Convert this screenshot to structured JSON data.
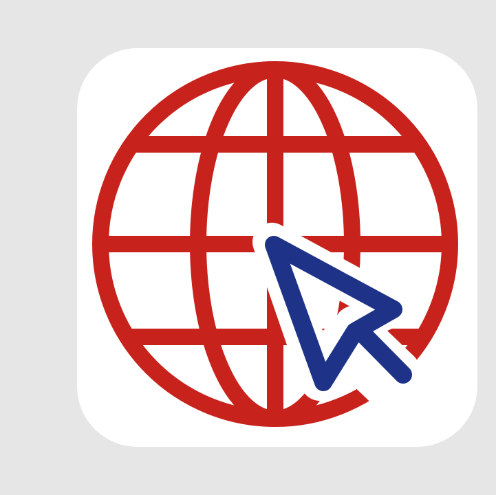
{
  "colors": {
    "background": "#e6e6e6",
    "tile": "#ffffff",
    "globe": "#c8221c",
    "cursor": "#1e3388",
    "cursor_outline": "#ffffff"
  },
  "icons": {
    "app_icon": "globe-with-cursor-icon",
    "globe": "globe-icon",
    "cursor": "mouse-pointer-icon"
  }
}
